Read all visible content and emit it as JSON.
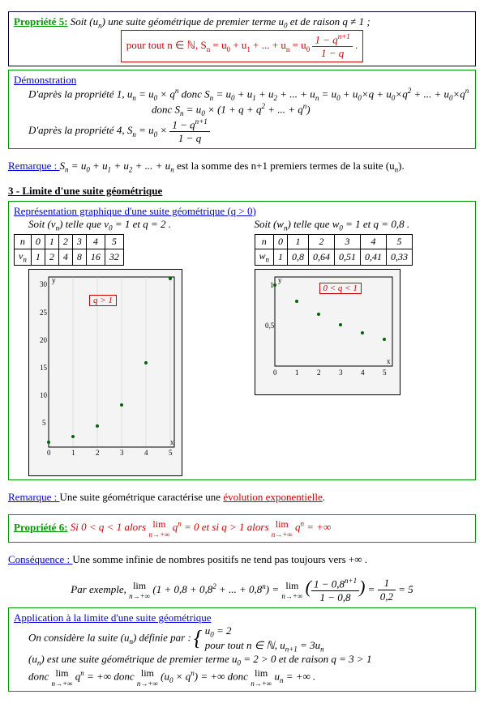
{
  "p5": {
    "title": "Propriété 5:",
    "txt1": "Soit (u",
    "txt1b": ") une suite géométrique de premier terme ",
    "txt1c": " et de raison q ≠ 1 ;",
    "formula_lead": "pour tout n ∈ ℕ, S",
    "formula_mid": " = u",
    "formula_sum": " + u",
    "formula_eq": " = u",
    "frac_n": "1 − q",
    "frac_nexp": "n+1",
    "frac_d": "1 − q"
  },
  "demo": {
    "title": "Démonstration",
    "l1a": "D'après la propriété 1, ",
    "l1b": " donc ",
    "l2": "donc ",
    "l3": "D'après la propriété 4, "
  },
  "rem1": {
    "lead": "Remarque : ",
    "txt": " est la somme des n+1 premiers termes de la suite (u",
    "tail": ")."
  },
  "sec3": "3 - Limite d'une suite géométrique",
  "rep": {
    "title": "Représentation graphique d'une suite géométrique (q > 0)",
    "left_def": "Soit (v",
    "left_def2": ") telle que v",
    "left_def3": " = 1 et q = 2 .",
    "right_def": "Soit (w",
    "right_def2": ") telle que w",
    "right_def3": " = 1 et q = 0,8 .",
    "legend_l": "q > 1",
    "legend_r": "0 < q < 1"
  },
  "tblL": {
    "head": [
      "n",
      "0",
      "1",
      "2",
      "3",
      "4",
      "5"
    ],
    "row": [
      "v",
      "1",
      "2",
      "4",
      "8",
      "16",
      "32"
    ]
  },
  "tblR": {
    "head": [
      "n",
      "0",
      "1",
      "2",
      "3",
      "4",
      "5"
    ],
    "row": [
      "w",
      "1",
      "0,8",
      "0,64",
      "0,51",
      "0,41",
      "0,33"
    ]
  },
  "rem2": {
    "lead": "Remarque : ",
    "txt": "Une suite géométrique caractérise une ",
    "link": "évolution exponentielle",
    "tail": "."
  },
  "p6": {
    "title": "Propriété 6:",
    "txt": "Si 0 < q < 1 alors ",
    "mid": " = 0   et si q > 1 alors ",
    "end": " = +∞"
  },
  "cons": {
    "lead": "Conséquence : ",
    "txt": "Une somme infinie de nombres positifs ne tend pas toujours vers +∞ .",
    "ex_lead": "Par exemple, ",
    "ex_res": " = 5"
  },
  "app": {
    "title": "Application à la limite d'une suite géométrique",
    "l1": "On considère la suite (u",
    "l1b": ") définie par : ",
    "c1": "u",
    "c1b": " = 2",
    "c2": "pour tout n ∈ ℕ, u",
    "c2b": " = 3u",
    "l2a": "(u",
    "l2b": ") est une suite géométrique de premier terme u",
    "l2c": " = 2 > 0 et de raison q = 3 > 1",
    "l3a": "donc ",
    "l3b": " = +∞   donc ",
    "l3c": " = +∞   donc ",
    "l3d": " = +∞ ."
  },
  "chart_data": [
    {
      "type": "scatter",
      "title": "q>1",
      "x": [
        0,
        1,
        2,
        3,
        4,
        5
      ],
      "y": [
        1,
        2,
        4,
        8,
        16,
        32
      ],
      "xlim": [
        0,
        5
      ],
      "ylim": [
        0,
        32
      ],
      "xlabel": "x",
      "ylabel": "y"
    },
    {
      "type": "scatter",
      "title": "0<q<1",
      "x": [
        0,
        1,
        2,
        3,
        4,
        5
      ],
      "y": [
        1,
        0.8,
        0.64,
        0.51,
        0.41,
        0.33
      ],
      "xlim": [
        0,
        5
      ],
      "ylim": [
        0,
        1
      ],
      "xlabel": "x",
      "ylabel": "y"
    }
  ]
}
